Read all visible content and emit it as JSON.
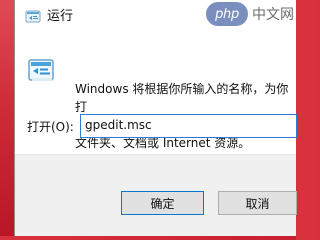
{
  "background": {
    "desktop_color": "#c61f2f"
  },
  "dialog": {
    "title": "运行",
    "watermark_logo": "php",
    "watermark_text": "中文网",
    "icons": {
      "title": "run-window-icon",
      "content": "run-window-icon"
    },
    "description_line_1": "Windows 将根据你所输入的名称，为你打",
    "description_line_2": "文件夹、文档或 Internet 资源。",
    "open_label": "打开(O):",
    "open_value": "gpedit.msc",
    "ok_label": "确定",
    "cancel_label": "取消",
    "accent": "#0b74d1"
  }
}
